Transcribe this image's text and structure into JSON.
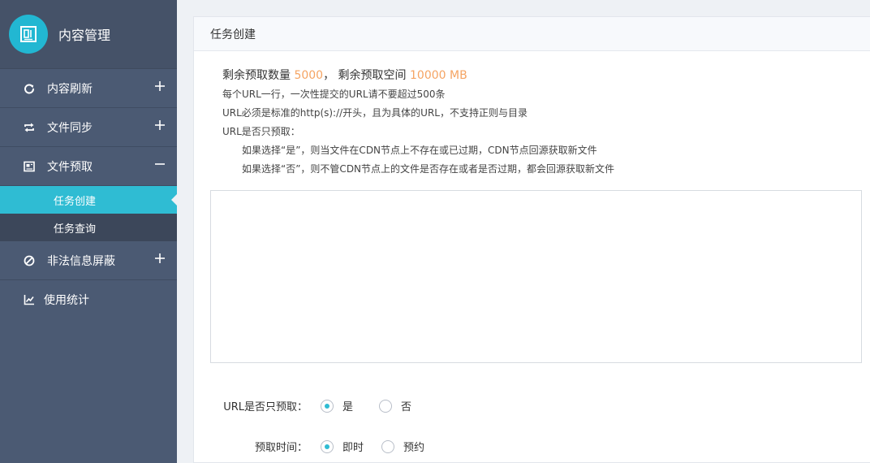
{
  "brand": {
    "title": "内容管理",
    "logo_icon": "panel-icon"
  },
  "sidebar": {
    "items": [
      {
        "label": "内容刷新",
        "icon": "refresh-icon",
        "toggle": "+"
      },
      {
        "label": "文件同步",
        "icon": "sync-icon",
        "toggle": "+"
      },
      {
        "label": "文件预取",
        "icon": "prefetch-icon",
        "toggle": "−"
      },
      {
        "label": "非法信息屏蔽",
        "icon": "block-icon",
        "toggle": "+"
      },
      {
        "label": "使用统计",
        "icon": "chart-icon"
      }
    ],
    "sub_items": [
      {
        "label": "任务创建",
        "active": true
      },
      {
        "label": "任务查询",
        "active": false
      }
    ]
  },
  "panel": {
    "title": "任务创建",
    "quota": {
      "count_label": "剩余预取数量",
      "count_value": "5000",
      "separator": "，",
      "space_label": "剩余预取空间",
      "space_value": "10000 MB"
    },
    "notes": [
      "每个URL一行，一次性提交的URL请不要超过500条",
      "URL必须是标准的http(s)://开头，且为具体的URL，不支持正则与目录",
      "URL是否只预取："
    ],
    "notes_indent": [
      "如果选择“是”，则当文件在CDN节点上不存在或已过期，CDN节点回源获取新文件",
      "如果选择“否”，则不管CDN节点上的文件是否存在或者是否过期，都会回源获取新文件"
    ],
    "url_input": {
      "value": "",
      "placeholder": ""
    },
    "form": {
      "only_prefetch": {
        "label": "URL是否只预取：",
        "options": [
          "是",
          "否"
        ],
        "selected": "是"
      },
      "prefetch_time": {
        "label": "预取时间：",
        "options": [
          "即时",
          "预约"
        ],
        "selected": "即时"
      }
    }
  },
  "colors": {
    "sidebar_bg": "#4b5a73",
    "accent": "#2fbcd3",
    "quota_highlight": "#f5a463"
  }
}
